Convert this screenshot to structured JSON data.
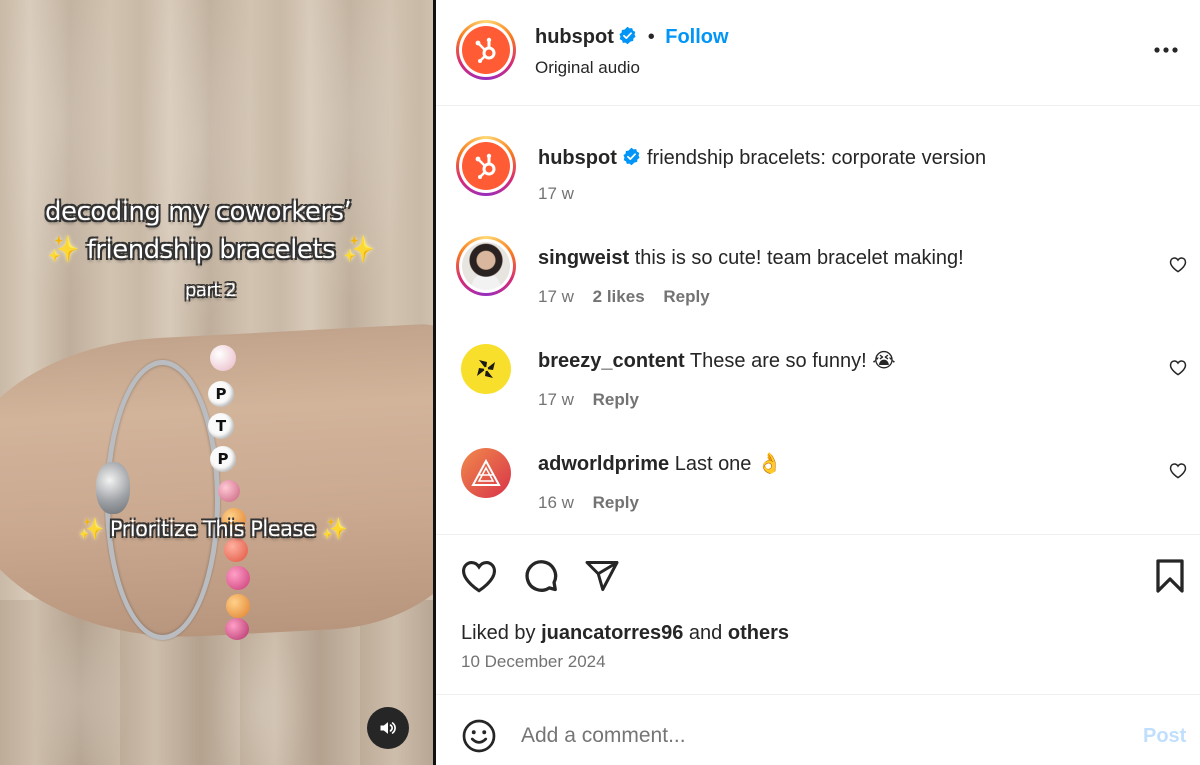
{
  "media": {
    "overlay_line1": "decoding my coworkers’",
    "overlay_line2": "friendship bracelets",
    "overlay_line3": "part 2",
    "overlay_caption": "Prioritize This Please",
    "bead_letters": [
      "P",
      "T",
      "P"
    ],
    "sparkle_glyph": "✨"
  },
  "header": {
    "username": "hubspot",
    "dot": "•",
    "follow_label": "Follow",
    "audio_label": "Original audio"
  },
  "caption": {
    "username": "hubspot",
    "text": "friendship bracelets: corporate version",
    "time": "17 w"
  },
  "comments": [
    {
      "username": "singweist",
      "text": "this is so cute! team bracelet making!",
      "time": "17 w",
      "likes": "2 likes",
      "reply": "Reply"
    },
    {
      "username": "breezy_content",
      "text": "These are so funny!",
      "emoji": "😭",
      "time": "17 w",
      "reply": "Reply"
    },
    {
      "username": "adworldprime",
      "text": "Last one",
      "emoji": "👌",
      "time": "16 w",
      "reply": "Reply"
    }
  ],
  "likes": {
    "prefix": "Liked by",
    "user": "juancatorres96",
    "middle": "and",
    "others": "others",
    "date": "10 December 2024"
  },
  "add_comment": {
    "placeholder": "Add a comment...",
    "post_label": "Post"
  },
  "colors": {
    "accent_blue": "#0095f6",
    "hubspot_orange": "#ff5c35",
    "muted_text": "#737373",
    "post_disabled": "#c0dffd"
  }
}
